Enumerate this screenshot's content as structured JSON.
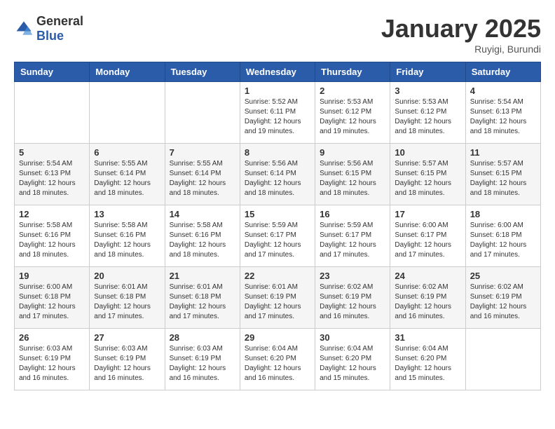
{
  "logo": {
    "general": "General",
    "blue": "Blue"
  },
  "title": "January 2025",
  "subtitle": "Ruyigi, Burundi",
  "days_of_week": [
    "Sunday",
    "Monday",
    "Tuesday",
    "Wednesday",
    "Thursday",
    "Friday",
    "Saturday"
  ],
  "weeks": [
    [
      {
        "day": "",
        "info": ""
      },
      {
        "day": "",
        "info": ""
      },
      {
        "day": "",
        "info": ""
      },
      {
        "day": "1",
        "info": "Sunrise: 5:52 AM\nSunset: 6:11 PM\nDaylight: 12 hours and 19 minutes."
      },
      {
        "day": "2",
        "info": "Sunrise: 5:53 AM\nSunset: 6:12 PM\nDaylight: 12 hours and 19 minutes."
      },
      {
        "day": "3",
        "info": "Sunrise: 5:53 AM\nSunset: 6:12 PM\nDaylight: 12 hours and 18 minutes."
      },
      {
        "day": "4",
        "info": "Sunrise: 5:54 AM\nSunset: 6:13 PM\nDaylight: 12 hours and 18 minutes."
      }
    ],
    [
      {
        "day": "5",
        "info": "Sunrise: 5:54 AM\nSunset: 6:13 PM\nDaylight: 12 hours and 18 minutes."
      },
      {
        "day": "6",
        "info": "Sunrise: 5:55 AM\nSunset: 6:14 PM\nDaylight: 12 hours and 18 minutes."
      },
      {
        "day": "7",
        "info": "Sunrise: 5:55 AM\nSunset: 6:14 PM\nDaylight: 12 hours and 18 minutes."
      },
      {
        "day": "8",
        "info": "Sunrise: 5:56 AM\nSunset: 6:14 PM\nDaylight: 12 hours and 18 minutes."
      },
      {
        "day": "9",
        "info": "Sunrise: 5:56 AM\nSunset: 6:15 PM\nDaylight: 12 hours and 18 minutes."
      },
      {
        "day": "10",
        "info": "Sunrise: 5:57 AM\nSunset: 6:15 PM\nDaylight: 12 hours and 18 minutes."
      },
      {
        "day": "11",
        "info": "Sunrise: 5:57 AM\nSunset: 6:15 PM\nDaylight: 12 hours and 18 minutes."
      }
    ],
    [
      {
        "day": "12",
        "info": "Sunrise: 5:58 AM\nSunset: 6:16 PM\nDaylight: 12 hours and 18 minutes."
      },
      {
        "day": "13",
        "info": "Sunrise: 5:58 AM\nSunset: 6:16 PM\nDaylight: 12 hours and 18 minutes."
      },
      {
        "day": "14",
        "info": "Sunrise: 5:58 AM\nSunset: 6:16 PM\nDaylight: 12 hours and 18 minutes."
      },
      {
        "day": "15",
        "info": "Sunrise: 5:59 AM\nSunset: 6:17 PM\nDaylight: 12 hours and 17 minutes."
      },
      {
        "day": "16",
        "info": "Sunrise: 5:59 AM\nSunset: 6:17 PM\nDaylight: 12 hours and 17 minutes."
      },
      {
        "day": "17",
        "info": "Sunrise: 6:00 AM\nSunset: 6:17 PM\nDaylight: 12 hours and 17 minutes."
      },
      {
        "day": "18",
        "info": "Sunrise: 6:00 AM\nSunset: 6:18 PM\nDaylight: 12 hours and 17 minutes."
      }
    ],
    [
      {
        "day": "19",
        "info": "Sunrise: 6:00 AM\nSunset: 6:18 PM\nDaylight: 12 hours and 17 minutes."
      },
      {
        "day": "20",
        "info": "Sunrise: 6:01 AM\nSunset: 6:18 PM\nDaylight: 12 hours and 17 minutes."
      },
      {
        "day": "21",
        "info": "Sunrise: 6:01 AM\nSunset: 6:18 PM\nDaylight: 12 hours and 17 minutes."
      },
      {
        "day": "22",
        "info": "Sunrise: 6:01 AM\nSunset: 6:19 PM\nDaylight: 12 hours and 17 minutes."
      },
      {
        "day": "23",
        "info": "Sunrise: 6:02 AM\nSunset: 6:19 PM\nDaylight: 12 hours and 16 minutes."
      },
      {
        "day": "24",
        "info": "Sunrise: 6:02 AM\nSunset: 6:19 PM\nDaylight: 12 hours and 16 minutes."
      },
      {
        "day": "25",
        "info": "Sunrise: 6:02 AM\nSunset: 6:19 PM\nDaylight: 12 hours and 16 minutes."
      }
    ],
    [
      {
        "day": "26",
        "info": "Sunrise: 6:03 AM\nSunset: 6:19 PM\nDaylight: 12 hours and 16 minutes."
      },
      {
        "day": "27",
        "info": "Sunrise: 6:03 AM\nSunset: 6:19 PM\nDaylight: 12 hours and 16 minutes."
      },
      {
        "day": "28",
        "info": "Sunrise: 6:03 AM\nSunset: 6:19 PM\nDaylight: 12 hours and 16 minutes."
      },
      {
        "day": "29",
        "info": "Sunrise: 6:04 AM\nSunset: 6:20 PM\nDaylight: 12 hours and 16 minutes."
      },
      {
        "day": "30",
        "info": "Sunrise: 6:04 AM\nSunset: 6:20 PM\nDaylight: 12 hours and 15 minutes."
      },
      {
        "day": "31",
        "info": "Sunrise: 6:04 AM\nSunset: 6:20 PM\nDaylight: 12 hours and 15 minutes."
      },
      {
        "day": "",
        "info": ""
      }
    ]
  ]
}
